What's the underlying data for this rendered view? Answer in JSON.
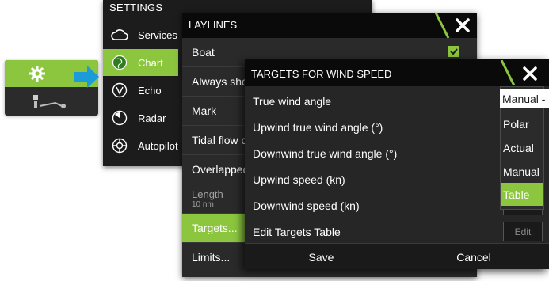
{
  "colors": {
    "accent": "#8cc63f",
    "arrow": "#1b9bd7",
    "window_bg": "#2a2a2a",
    "title_bar_bg": "#0a0a0a"
  },
  "callout": {
    "icon": "gear-icon",
    "arrow_icon": "arrow-right-icon"
  },
  "settings": {
    "title": "SETTINGS",
    "items": [
      {
        "label": "Services",
        "icon": "cloud-icon"
      },
      {
        "label": "Chart",
        "icon": "chart-globe-icon",
        "selected": true
      },
      {
        "label": "Echo",
        "icon": "echo-icon"
      },
      {
        "label": "Radar",
        "icon": "radar-icon"
      },
      {
        "label": "Autopilot",
        "icon": "autopilot-icon"
      }
    ]
  },
  "laylines": {
    "title": "LAYLINES",
    "rows": [
      {
        "label": "Boat",
        "checked": true
      },
      {
        "label": "Always show"
      },
      {
        "label": "Mark"
      },
      {
        "label": "Tidal flow corrected"
      },
      {
        "label": "Overlapped"
      },
      {
        "label": "Length",
        "sub": "10 nm"
      },
      {
        "label": "Targets...",
        "selected": true
      },
      {
        "label": "Limits..."
      }
    ]
  },
  "targets": {
    "title": "TARGETS FOR WIND SPEED",
    "rows": [
      {
        "label": "True wind angle",
        "value": "Manual -"
      },
      {
        "label": "Upwind true wind angle (°)"
      },
      {
        "label": "Downwind true wind angle (°)"
      },
      {
        "label": "Upwind speed (kn)"
      },
      {
        "label": "Downwind speed (kn)"
      },
      {
        "label": "Edit Targets Table",
        "button": "Edit"
      }
    ],
    "dropdown_options": [
      "Polar",
      "Actual",
      "Manual",
      "Table"
    ],
    "dropdown_selected": "Table",
    "save_label": "Save",
    "cancel_label": "Cancel"
  }
}
